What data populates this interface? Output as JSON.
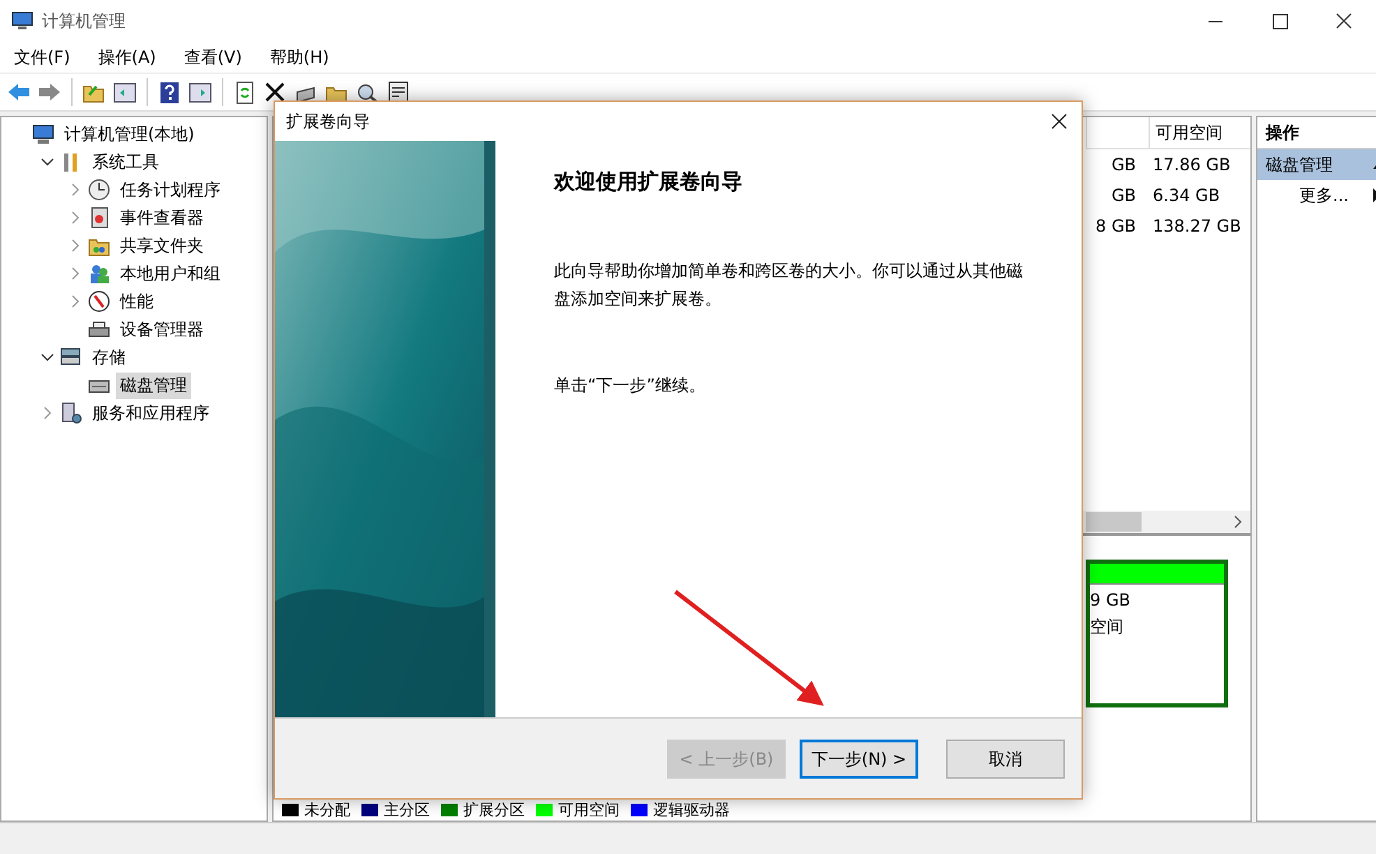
{
  "window": {
    "title": "计算机管理"
  },
  "menu": [
    {
      "label": "文件(F)"
    },
    {
      "label": "操作(A)"
    },
    {
      "label": "查看(V)"
    },
    {
      "label": "帮助(H)"
    }
  ],
  "tree": [
    {
      "label": "计算机管理(本地)",
      "selected": false,
      "children": [
        {
          "label": "系统工具",
          "expanded": true,
          "selected": false,
          "children": [
            {
              "label": "任务计划程序",
              "expanded": false,
              "selected": false
            },
            {
              "label": "事件查看器",
              "expanded": false,
              "selected": false
            },
            {
              "label": "共享文件夹",
              "expanded": false,
              "selected": false
            },
            {
              "label": "本地用户和组",
              "expanded": false,
              "selected": false
            },
            {
              "label": "性能",
              "expanded": false,
              "selected": false
            },
            {
              "label": "设备管理器",
              "selected": false
            }
          ]
        },
        {
          "label": "存储",
          "expanded": true,
          "selected": false,
          "children": [
            {
              "label": "磁盘管理",
              "selected": true
            }
          ]
        },
        {
          "label": "服务和应用程序",
          "expanded": false,
          "selected": false
        }
      ]
    }
  ],
  "table": {
    "columns": [
      "可用空间"
    ],
    "rows": [
      {
        "column_1": "GB",
        "free": "17.86 GB"
      },
      {
        "column_1": "GB",
        "free": "6.34 GB"
      },
      {
        "column_1": "8 GB",
        "free": "138.27 GB"
      }
    ]
  },
  "disk_map": {
    "lines": [
      "9 GB",
      "空间"
    ]
  },
  "legend": [
    {
      "label": "未分配",
      "color": "#000000"
    },
    {
      "label": "主分区",
      "color": "#000080"
    },
    {
      "label": "扩展分区",
      "color": "#008000"
    },
    {
      "label": "可用空间",
      "color": "#00ff00"
    },
    {
      "label": "逻辑驱动器",
      "color": "#0000ff"
    }
  ],
  "actions": {
    "title": "操作",
    "items": [
      {
        "label": "磁盘管理",
        "kind": "section"
      },
      {
        "label": "更多...",
        "kind": "link"
      }
    ]
  },
  "dialog": {
    "title": "扩展卷向导",
    "heading": "欢迎使用扩展卷向导",
    "paragraphs": [
      "此向导帮助你增加简单卷和跨区卷的大小。你可以通过从其他磁盘添加空间来扩展卷。",
      "单击“下一步”继续。"
    ],
    "buttons": [
      {
        "label": "< 上一步(B)",
        "disabled": true,
        "focused": false
      },
      {
        "label": "下一步(N) >",
        "disabled": false,
        "focused": true
      },
      {
        "label": "取消",
        "disabled": false,
        "focused": false
      }
    ]
  }
}
